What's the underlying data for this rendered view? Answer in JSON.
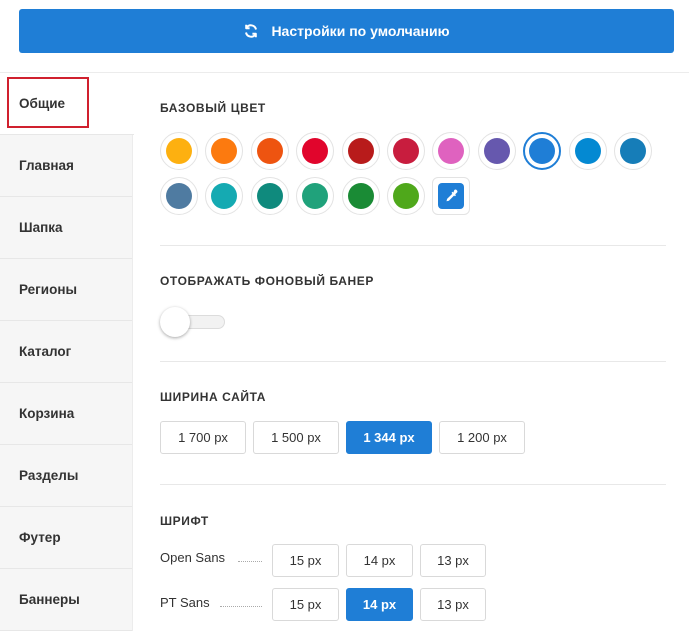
{
  "header": {
    "reset_label": "Настройки по умолчанию",
    "reset_icon": "refresh-icon"
  },
  "sidebar": {
    "items": [
      {
        "label": "Общие",
        "active": true
      },
      {
        "label": "Главная"
      },
      {
        "label": "Шапка"
      },
      {
        "label": "Регионы"
      },
      {
        "label": "Каталог"
      },
      {
        "label": "Корзина"
      },
      {
        "label": "Разделы"
      },
      {
        "label": "Футер"
      },
      {
        "label": "Баннеры"
      }
    ]
  },
  "base_color": {
    "title": "БАЗОВЫЙ ЦВЕТ",
    "selected": "#1f7ed6",
    "swatches": [
      "#fdb010",
      "#fc7a0f",
      "#ee5410",
      "#e1052c",
      "#b81b1b",
      "#c81d3e",
      "#df62bf",
      "#6658ae",
      "#1f7ed6",
      "#0489d2",
      "#167db8",
      "#4f7ba1",
      "#15aab2",
      "#0f8a7d",
      "#20a27b",
      "#1a8b35",
      "#4fa81b"
    ],
    "custom_icon": "eyedropper-icon"
  },
  "banner": {
    "title": "ОТОБРАЖАТЬ ФОНОВЫЙ БАНЕР",
    "enabled": false
  },
  "site_width": {
    "title": "ШИРИНА САЙТА",
    "options": [
      "1 700 px",
      "1 500 px",
      "1 344 px",
      "1 200 px"
    ],
    "selected": "1 344 px"
  },
  "font": {
    "title": "ШРИФТ",
    "rows": [
      {
        "name": "Open Sans",
        "sizes": [
          "15 px",
          "14 px",
          "13 px"
        ],
        "selected": null
      },
      {
        "name": "PT Sans",
        "sizes": [
          "15 px",
          "14 px",
          "13 px"
        ],
        "selected": "14 px"
      }
    ]
  },
  "colors": {
    "accent": "#1f7ed6",
    "highlight_frame": "#d0202e"
  }
}
